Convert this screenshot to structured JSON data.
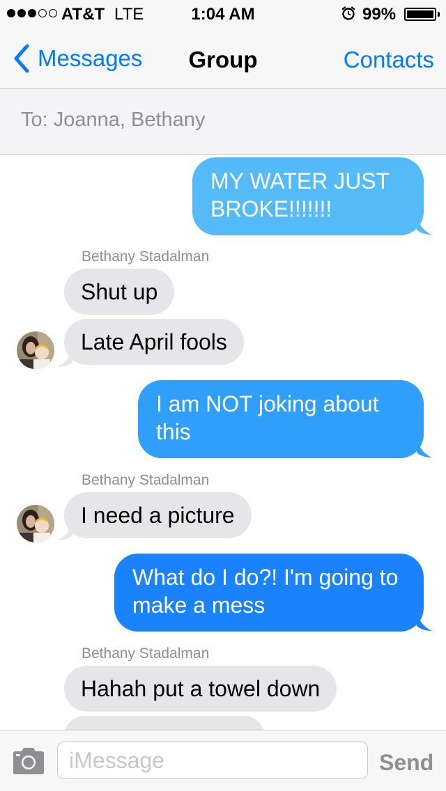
{
  "status_bar": {
    "carrier": "AT&T",
    "network": "LTE",
    "time": "1:04 AM",
    "battery_percent": "99%",
    "battery_level": 0.99,
    "signal_bars_filled": 3,
    "signal_bars_total": 5,
    "alarm_icon": "alarm-clock-icon"
  },
  "nav": {
    "back_label": "Messages",
    "back_icon": "chevron-left-icon",
    "title": "Group",
    "right_label": "Contacts"
  },
  "recipients": {
    "text": "To: Joanna, Bethany"
  },
  "messages": [
    {
      "direction": "outgoing",
      "text": "MY WATER JUST BROKE!!!!!!!"
    },
    {
      "direction": "incoming",
      "sender": "Bethany Stadalman",
      "text": "Shut up"
    },
    {
      "direction": "incoming",
      "text": "Late April fools"
    },
    {
      "direction": "outgoing",
      "text": "I am NOT joking about this"
    },
    {
      "direction": "incoming",
      "sender": "Bethany Stadalman",
      "text": "I need a picture"
    },
    {
      "direction": "outgoing",
      "text": "What do I do?! I'm going to make a mess"
    },
    {
      "direction": "incoming",
      "sender": "Bethany Stadalman",
      "text": "Hahah put a towel down"
    }
  ],
  "input_bar": {
    "camera_icon": "camera-icon",
    "placeholder": "iMessage",
    "send_label": "Send"
  },
  "colors": {
    "ios_blue": "#007aff",
    "incoming_bubble": "#e5e5ea",
    "outgoing_light": "#5ac8fa",
    "outgoing_dark": "#1a82fb",
    "secondary_text": "#8e8e93"
  }
}
